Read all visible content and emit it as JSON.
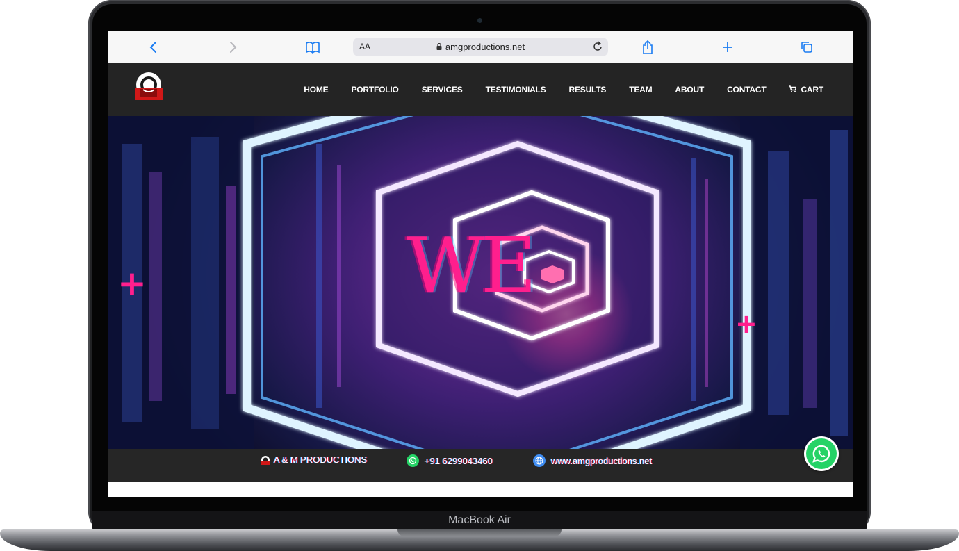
{
  "device": {
    "label": "MacBook Air"
  },
  "browser": {
    "text_size_label": "AA",
    "url": "amgproductions.net"
  },
  "site": {
    "nav": [
      {
        "label": "HOME"
      },
      {
        "label": "PORTFOLIO"
      },
      {
        "label": "SERVICES"
      },
      {
        "label": "TESTIMONIALS"
      },
      {
        "label": "RESULTS"
      },
      {
        "label": "TEAM"
      },
      {
        "label": "ABOUT"
      },
      {
        "label": "CONTACT"
      },
      {
        "label": "CART",
        "icon": "cart-icon"
      }
    ],
    "hero": {
      "headline": "WE",
      "plus_glyph": "+"
    },
    "footer_strip": {
      "brand": "A & M PRODUCTIONS",
      "phone": "+91 6299043460",
      "website": "www.amgproductions.net"
    }
  },
  "colors": {
    "accent_pink": "#ff1f8d",
    "nav_bg": "#242424",
    "browser_blue": "#1a7cf2",
    "whatsapp_green": "#25d366"
  }
}
